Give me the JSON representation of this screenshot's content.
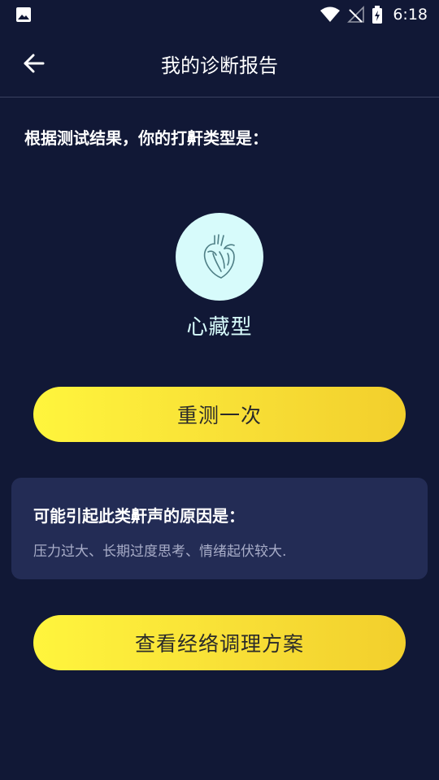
{
  "status_bar": {
    "time": "6:18",
    "icons": [
      "image-icon",
      "wifi-icon",
      "no-signal-icon",
      "battery-icon"
    ]
  },
  "header": {
    "back_icon": "back-arrow-icon",
    "title": "我的诊断报告"
  },
  "result": {
    "heading": "根据测试结果，你的打鼾类型是：",
    "icon": "heart-icon",
    "type_name": "心藏型"
  },
  "actions": {
    "retest_label": "重测一次",
    "plan_label": "查看经络调理方案"
  },
  "cause_card": {
    "title": "可能引起此类鼾声的原因是：",
    "text": "压力过大、长期过度思考、情绪起伏较大."
  },
  "colors": {
    "background": "#111836",
    "card": "#232c55",
    "accent_yellow": "#f8df36",
    "circle": "#d7fbfb",
    "type_text": "#d7fbfb"
  }
}
